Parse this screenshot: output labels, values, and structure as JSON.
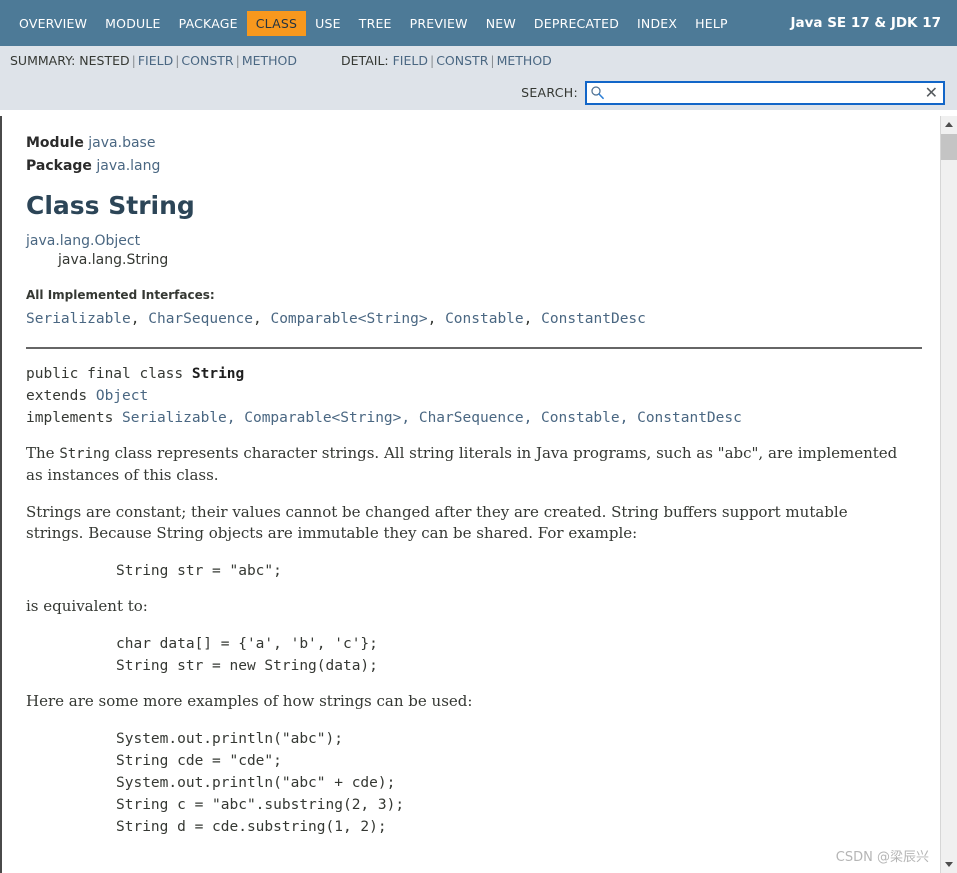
{
  "topnav": {
    "items": [
      {
        "label": "OVERVIEW",
        "active": false
      },
      {
        "label": "MODULE",
        "active": false
      },
      {
        "label": "PACKAGE",
        "active": false
      },
      {
        "label": "CLASS",
        "active": true
      },
      {
        "label": "USE",
        "active": false
      },
      {
        "label": "TREE",
        "active": false
      },
      {
        "label": "PREVIEW",
        "active": false
      },
      {
        "label": "NEW",
        "active": false
      },
      {
        "label": "DEPRECATED",
        "active": false
      },
      {
        "label": "INDEX",
        "active": false
      },
      {
        "label": "HELP",
        "active": false
      }
    ],
    "title": "Java SE 17 & JDK 17",
    "bg_color": "#4D7A97",
    "active_bg_color": "#F8981D"
  },
  "subnav": {
    "summary_label": "SUMMARY:",
    "summary_items": [
      {
        "label": "NESTED",
        "link": false
      },
      {
        "label": "FIELD",
        "link": true
      },
      {
        "label": "CONSTR",
        "link": true
      },
      {
        "label": "METHOD",
        "link": true
      }
    ],
    "detail_label": "DETAIL:",
    "detail_items": [
      {
        "label": "FIELD",
        "link": true
      },
      {
        "label": "CONSTR",
        "link": true
      },
      {
        "label": "METHOD",
        "link": true
      }
    ],
    "separator": "|",
    "bg_color": "#dee3e9",
    "link_color": "#4A6782"
  },
  "search": {
    "label": "SEARCH:",
    "value": "",
    "placeholder": "",
    "clear_glyph": "✕",
    "border_color": "#1266c8"
  },
  "header": {
    "module_label": "Module",
    "module_name": "java.base",
    "package_label": "Package",
    "package_name": "java.lang",
    "class_title": "Class String",
    "title_color": "#2c4557"
  },
  "inheritance": {
    "parent": "java.lang.Object",
    "child": "java.lang.String"
  },
  "interfaces": {
    "label": "All Implemented Interfaces:",
    "items": [
      "Serializable",
      "CharSequence",
      "Comparable<String>",
      "Constable",
      "ConstantDesc"
    ],
    "text": "Serializable, CharSequence, Comparable<String>, Constable, ConstantDesc"
  },
  "declaration": {
    "line1_prefix": "public final class ",
    "line1_name": "String",
    "line2_kw": "extends ",
    "line2_type": "Object",
    "line3_kw": "implements ",
    "line3_types": "Serializable, Comparable<String>, CharSequence, Constable, ConstantDesc"
  },
  "body": {
    "para1": "The String class represents character strings. All string literals in Java programs, such as \"abc\", are implemented as instances of this class.",
    "para1_mono": "String",
    "para1_a": "The ",
    "para1_b": " class represents character strings. All string literals in Java programs, such as \"abc\", are implemented as instances of this class.",
    "para2": "Strings are constant; their values cannot be changed after they are created. String buffers support mutable strings. Because String objects are immutable they can be shared. For example:",
    "code1": "String str = \"abc\";",
    "para3": "is equivalent to:",
    "code2": "char data[] = {'a', 'b', 'c'};\nString str = new String(data);",
    "para4": "Here are some more examples of how strings can be used:",
    "code3": "System.out.println(\"abc\");\nString cde = \"cde\";\nSystem.out.println(\"abc\" + cde);\nString c = \"abc\".substring(2, 3);\nString d = cde.substring(1, 2);"
  },
  "watermark": {
    "text": "CSDN @梁辰兴"
  }
}
